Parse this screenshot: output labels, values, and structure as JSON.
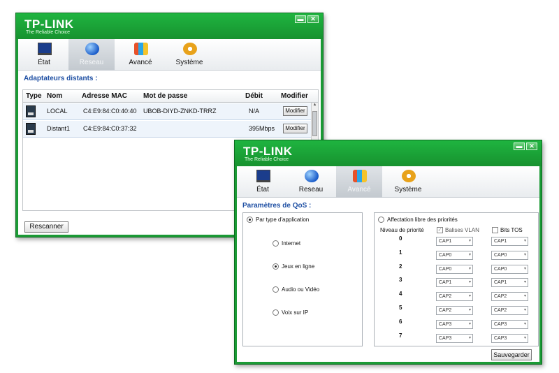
{
  "brand": {
    "logo": "TP-LINK",
    "tagline": "The Reliable Choice"
  },
  "tabs": [
    "État",
    "Reseau",
    "Avancé",
    "Système"
  ],
  "window1": {
    "section_title": "Adaptateurs distants :",
    "columns": [
      "Type",
      "Nom",
      "Adresse MAC",
      "Mot de passe",
      "Débit",
      "Modifier"
    ],
    "rows": [
      {
        "name": "LOCAL",
        "mac": "C4:E9:84:C0:40:40",
        "password": "UBOB-DIYD-ZNKD-TRRZ",
        "rate": "N/A",
        "button": "Modifier"
      },
      {
        "name": "Distant1",
        "mac": "C4:E9:84:C0:37:32",
        "password": "",
        "rate": "395Mbps",
        "button": "Modifier"
      }
    ],
    "rescan_label": "Rescanner"
  },
  "window2": {
    "section_title": "Paramètres de QoS :",
    "by_app_label": "Par type d'application",
    "apps": [
      "Internet",
      "Jeux en ligne",
      "Audio ou Vidéo",
      "Voix sur IP"
    ],
    "selected_app": 1,
    "free_label": "Affectation libre des priorités",
    "priority_header": "Niveau de priorité",
    "vlan_label": "Balises VLAN",
    "tos_label": "Bits TOS",
    "levels": [
      "0",
      "1",
      "2",
      "3",
      "4",
      "5",
      "6",
      "7"
    ],
    "vlan_values": [
      "CAP1",
      "CAP0",
      "CAP0",
      "CAP1",
      "CAP2",
      "CAP2",
      "CAP3",
      "CAP3"
    ],
    "tos_values": [
      "CAP1",
      "CAP0",
      "CAP0",
      "CAP1",
      "CAP2",
      "CAP2",
      "CAP3",
      "CAP3"
    ],
    "save_label": "Sauvegarder"
  }
}
